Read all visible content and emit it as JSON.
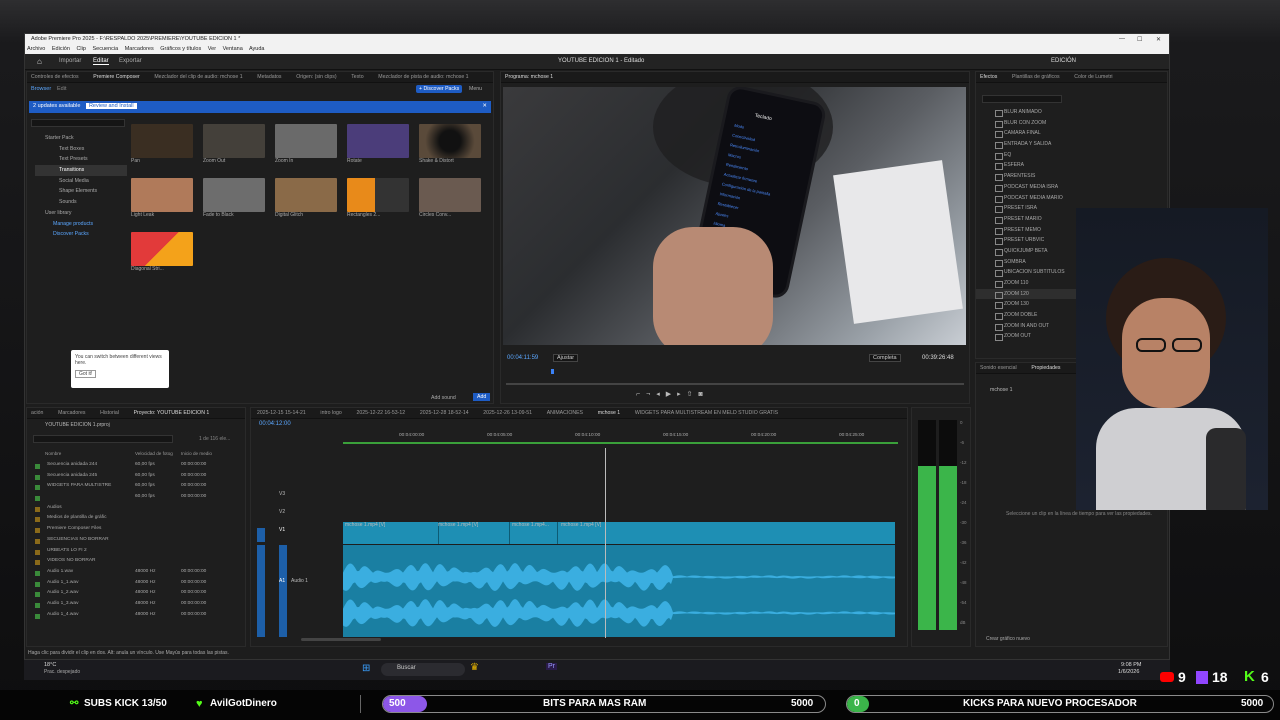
{
  "window": {
    "title": "Adobe Premiere Pro 2025 - F:\\RESPALDO 2025\\PREMIERE\\YOUTUBE EDICION 1 *",
    "menu": [
      "Archivo",
      "Edición",
      "Clip",
      "Secuencia",
      "Marcadores",
      "Gráficos y títulos",
      "Ver",
      "Ventana",
      "Ayuda"
    ],
    "controls": [
      "—",
      "☐",
      "✕"
    ]
  },
  "header": {
    "workspaces": [
      "Importar",
      "Editar",
      "Exportar"
    ],
    "doc_title": "YOUTUBE EDICION 1 - Editado",
    "edition_label": "EDICIÓN"
  },
  "source_panel": {
    "tabs": [
      "Controles de efectos",
      "Premiere Composer",
      "Mezclador del clip de audio: mchose 1",
      "Metadatos",
      "Origen: (sin clips)",
      "Texto",
      "Mezclador de pista de audio: mchose 1"
    ],
    "subtabs": [
      "Browser",
      "Edit"
    ],
    "discover_label": "+ Discover Packs",
    "menu_label": "Menu",
    "update_text": "2 updates available",
    "review_label": "Review and Install",
    "tree": [
      "Starter Pack",
      "Text Boxes",
      "Text Presets",
      "Transitions",
      "Social Media",
      "Shape Elements",
      "Sounds",
      "User library",
      "Manage products",
      "Discover Packs"
    ],
    "tiles": [
      {
        "label": "Pan",
        "color": "#3a2e22"
      },
      {
        "label": "Zoom Out",
        "color": "#44403a"
      },
      {
        "label": "Zoom In",
        "color": "#6a6a6a"
      },
      {
        "label": "Rotate",
        "color": "#4b3d7a"
      },
      {
        "label": "Shake & Distort",
        "color": "#1c1c1c"
      },
      {
        "label": "Light Leak",
        "color": "#b07a5a"
      },
      {
        "label": "Fade to Black",
        "color": "#6d6d6d"
      },
      {
        "label": "Digital Glitch",
        "color": "#8a6a48"
      },
      {
        "label": "Rectangles 2...",
        "color": "#e88a1a"
      },
      {
        "label": "Circles Conv...",
        "color": "#6a5a50"
      },
      {
        "label": "Diagonal Stri...",
        "color": "#e23a3a"
      }
    ],
    "tooltip": "You can switch between different views here.",
    "tooltip_button": "Got it!",
    "add_sound": "Add sound",
    "add_btn": "Add"
  },
  "program": {
    "tab": "Programa: mchose 1",
    "timecode": "00:04:11:59",
    "fit": "Ajustar",
    "quality": "Completa",
    "duration": "00:39:26:48",
    "phone_title": "Teclado",
    "phone_lines": [
      "Modo",
      "Conectividad",
      "Retroiluminación",
      "Macros",
      "Rendimiento",
      "Actualizar firmware",
      "Configuración de la pantalla",
      "Información",
      "Restablecer",
      "Ajustes",
      "Idioma",
      "Ayuda",
      "Soporte técnico",
      "Acerca de"
    ]
  },
  "timeline": {
    "tabs": [
      "2025-12-15 15-14-21",
      "intro logo",
      "2025-12-22 16-53-12",
      "2025-12-28 18-52-14",
      "2025-12-26 13-09-51",
      "ANIMACIONES",
      "mchose 1",
      "WIDGETS PARA MULTISTREAM EN MELD STUDIO GRATIS"
    ],
    "timecode": "00:04:12:00",
    "ruler": [
      "00:04:00:00",
      "00:04:05:00",
      "00:04:10:00",
      "00:04:15:00",
      "00:04:20:00",
      "00:04:25:00"
    ],
    "tracks": [
      "V3",
      "V2",
      "V1",
      "A1"
    ],
    "clips": [
      "mchose 1.mp4 [V]",
      "mchose 1.mp4 [V]",
      "mchose 1.mp4...",
      "mchose 1.mp4 [V]"
    ],
    "audio_label": "Audio 1"
  },
  "project": {
    "tabs": [
      "ación",
      "Marcadores",
      "Historial",
      "Proyecto: YOUTUBE EDICION 1"
    ],
    "file": "YOUTUBE EDICION 1.prproj",
    "count": "1 de 116 ele...",
    "headers": [
      "Nombre",
      "Velocidad de fotog",
      "Inicio de medio"
    ],
    "rows": [
      [
        "Secuencia anidada 244",
        "60,00 fps",
        "00:00:00:00"
      ],
      [
        "Secuencia anidada 245",
        "60,00 fps",
        "00:00:00:00"
      ],
      [
        "WIDGETS PARA MULTISTRE",
        "60,00 fps",
        "00:00:00:00"
      ],
      [
        "",
        "60,00 fps",
        "00:00:00:00"
      ],
      [
        "Audios",
        "",
        ""
      ],
      [
        "Medios de plantilla de gráfic",
        "",
        ""
      ],
      [
        "Premiere Composer Files",
        "",
        ""
      ],
      [
        "SECUENCIAS NO BORRAR",
        "",
        ""
      ],
      [
        "URBEATS LO FI 2",
        "",
        ""
      ],
      [
        "VIDEOS NO BORRAR",
        "",
        ""
      ],
      [
        "Audio 1.wav",
        "48000 Hz",
        "00:00:00:00"
      ],
      [
        "Audio 1_1.wav",
        "48000 Hz",
        "00:00:00:00"
      ],
      [
        "Audio 1_2.wav",
        "48000 Hz",
        "00:00:00:00"
      ],
      [
        "Audio 1_3.wav",
        "48000 Hz",
        "00:00:00:00"
      ],
      [
        "Audio 1_4.wav",
        "48000 Hz",
        "00:00:00:00"
      ]
    ]
  },
  "effects": {
    "tabs": [
      "Efectos",
      "Plantillas de gráficos",
      "Color de Lumetri"
    ],
    "items": [
      "BLUR ANIMADO",
      "BLUR CON ZOOM",
      "CAMARA FINAL",
      "ENTRADA Y SALIDA",
      "EQ",
      "ESFERA",
      "PARENTESIS",
      "PODCAST MEDIA ISRA",
      "PODCAST MEDIA MARIO",
      "PRESET ISRA",
      "PRESET MARIO",
      "PRESET MEMO",
      "PRESET URBVIC",
      "QUICKJUMP BETA",
      "SOMBRA",
      "UBICACION SUBTITULOS",
      "ZOOM 110",
      "ZOOM 120",
      "ZOOM 130",
      "ZOOM DOBLE",
      "ZOOM IN AND OUT",
      "ZOOM OUT"
    ]
  },
  "properties": {
    "tabs": [
      "Sonido esencial",
      "Propiedades"
    ],
    "seq": "mchose 1",
    "hint": "Seleccione un clip en la línea de tiempo para ver las propiedades.",
    "create": "Crear gráfico nuevo"
  },
  "meter_scale": [
    "0",
    "-6",
    "-12",
    "-18",
    "-24",
    "-30",
    "-36",
    "-42",
    "-48",
    "-54",
    "dB"
  ],
  "status": "Haga clic para dividir el clip en dos. Alt: anula un vínculo. Use Mayús para todas las pistas.",
  "taskbar": {
    "weather_temp": "18°C",
    "weather_text": "Prac. despejado",
    "search": "Buscar",
    "time": "9:08 PM",
    "date": "1/6/2026"
  },
  "stream": {
    "subs": "SUBS KICK 13/50",
    "donor": "AvilGotDinero",
    "goal1": {
      "start": "500",
      "label": "BITS PARA MAS RAM",
      "end": "5000"
    },
    "goal2": {
      "start": "0",
      "label": "KICKS PARA NUEVO PROCESADOR",
      "end": "5000"
    },
    "viewers": {
      "youtube": "9",
      "twitch": "18",
      "kick": "6"
    }
  },
  "colors": {
    "accent": "#1e5cc4",
    "timeline_clip": "#1e8fb4",
    "waveform": "#3aaee0",
    "meter": "#3bb54a",
    "kick": "#53fc18",
    "twitch": "#9146ff",
    "youtube": "#ff0000"
  }
}
